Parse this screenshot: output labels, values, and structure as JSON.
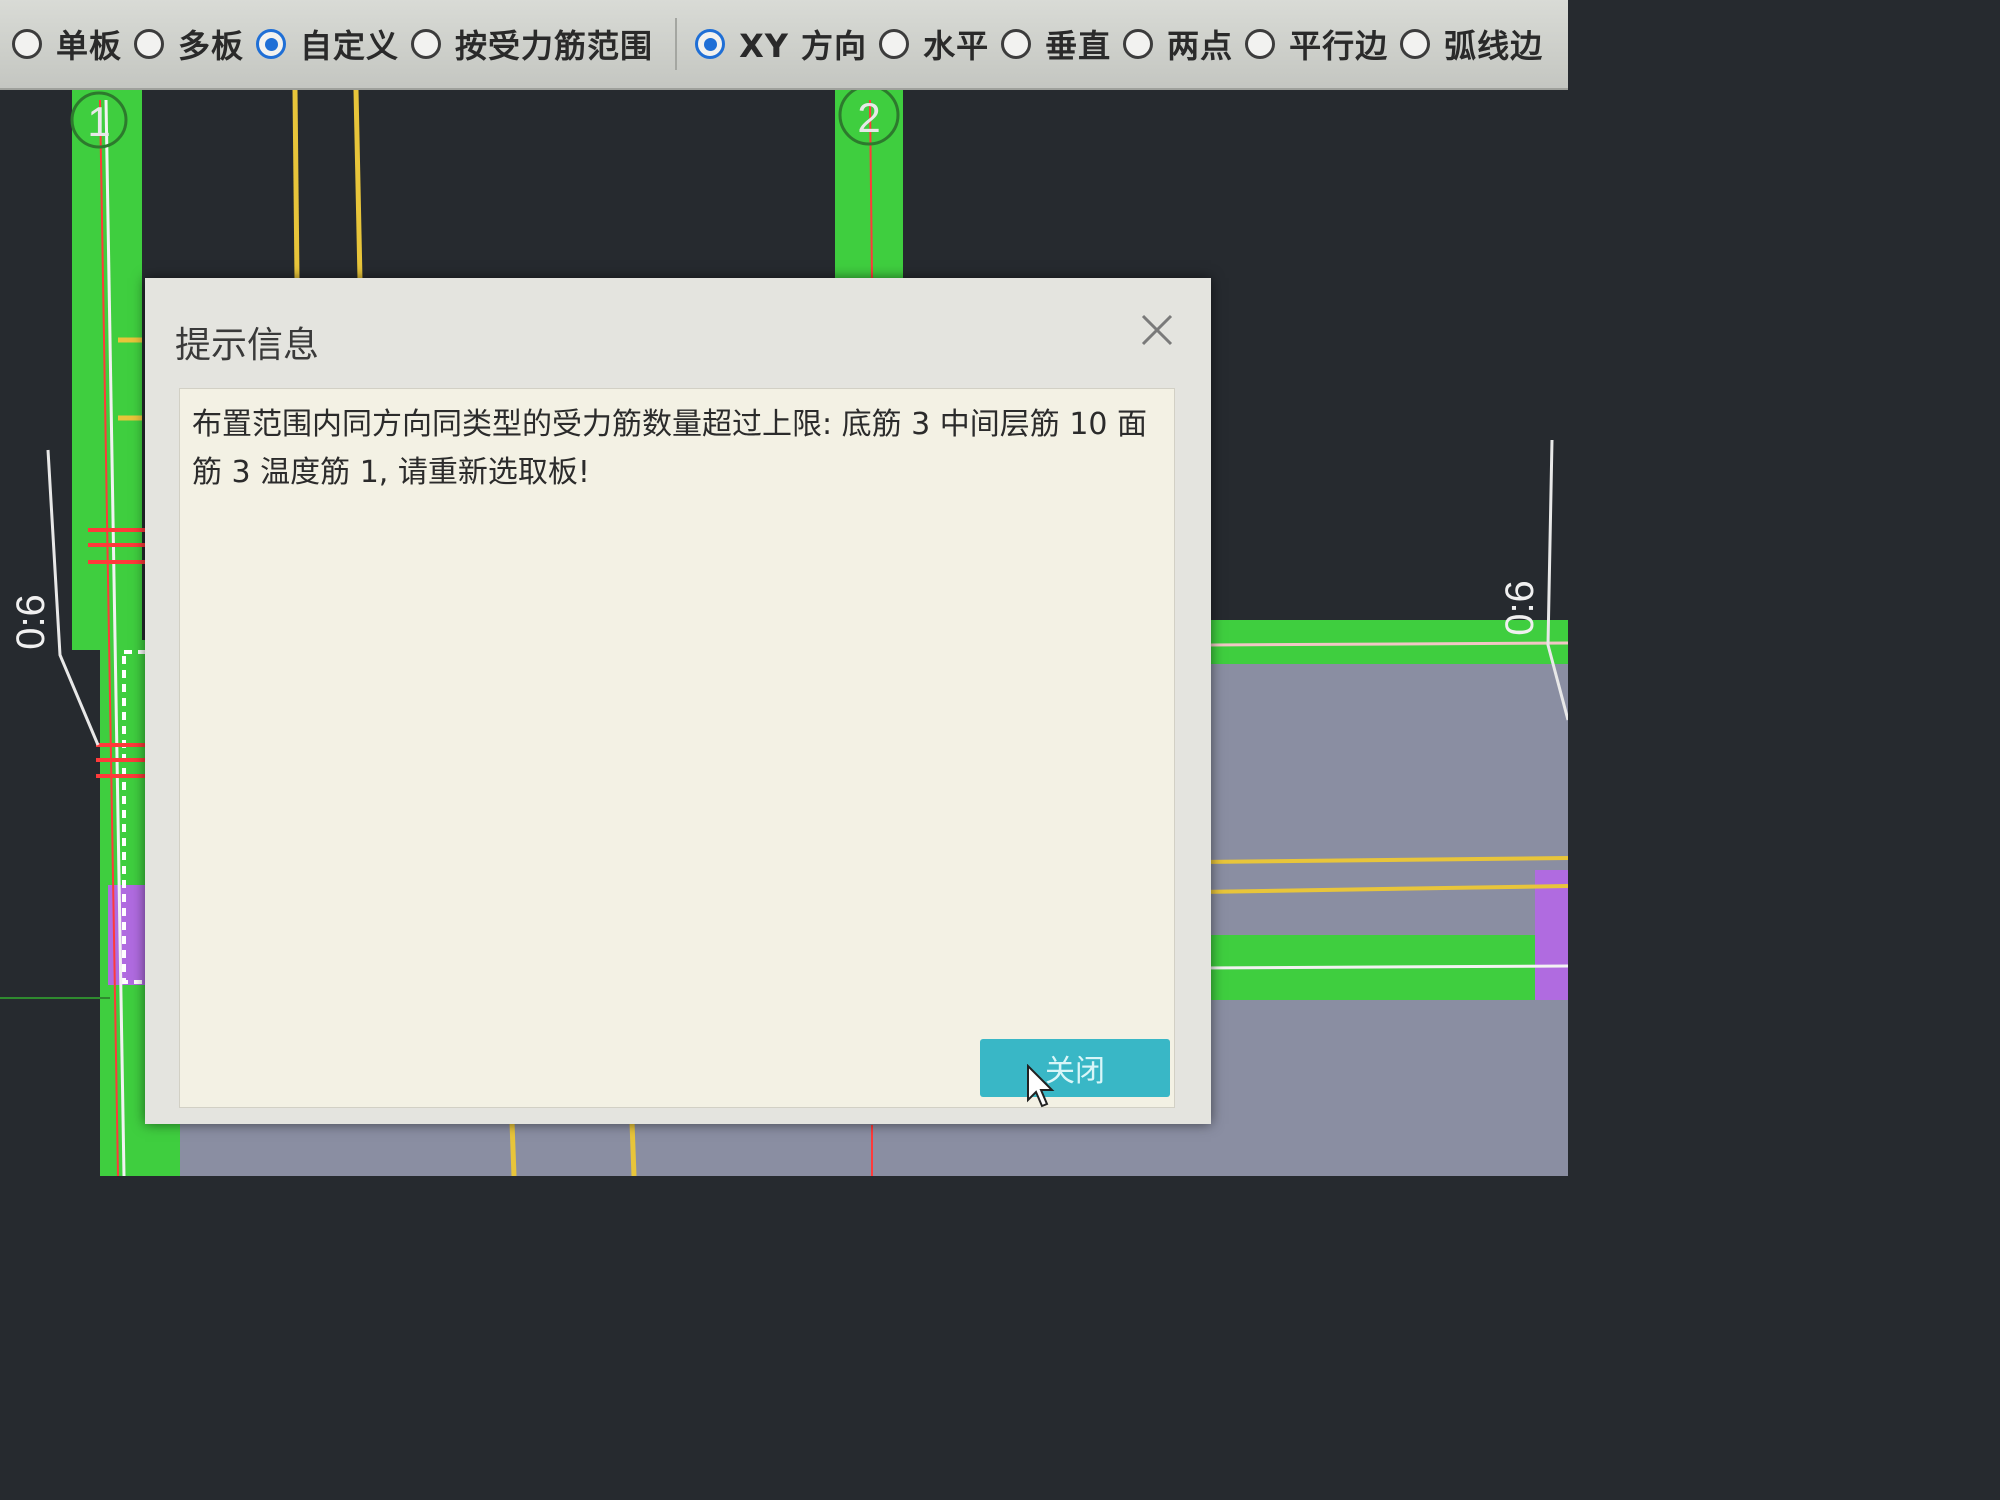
{
  "toolbar": {
    "options": [
      {
        "label": "单板",
        "selected": false
      },
      {
        "label": "多板",
        "selected": false
      },
      {
        "label": "自定义",
        "selected": true
      },
      {
        "label": "按受力筋范围",
        "selected": false
      },
      {
        "label": "XY 方向",
        "selected": true
      },
      {
        "label": "水平",
        "selected": false
      },
      {
        "label": "垂直",
        "selected": false
      },
      {
        "label": "两点",
        "selected": false
      },
      {
        "label": "平行边",
        "selected": false
      },
      {
        "label": "弧线边",
        "selected": false
      }
    ]
  },
  "canvas": {
    "axis_labels": [
      "1",
      "2"
    ],
    "dim_labels": [
      "0:6",
      "0:6"
    ]
  },
  "dialog": {
    "title": "提示信息",
    "message": "布置范围内同方向同类型的受力筋数量超过上限: 底筋 3 中间层筋 10 面筋 3 温度筋 1, 请重新选取板!",
    "close_button_label": "关闭"
  },
  "colors": {
    "canvas_background": "#262a2f",
    "beam_green": "#3fce3f",
    "slab_gray": "#8a8ea2",
    "rebar_yellow": "#e8c53a",
    "axis_red": "#ff3a3a",
    "accent_purple": "#b06be0",
    "button_teal": "#39b7c6"
  }
}
